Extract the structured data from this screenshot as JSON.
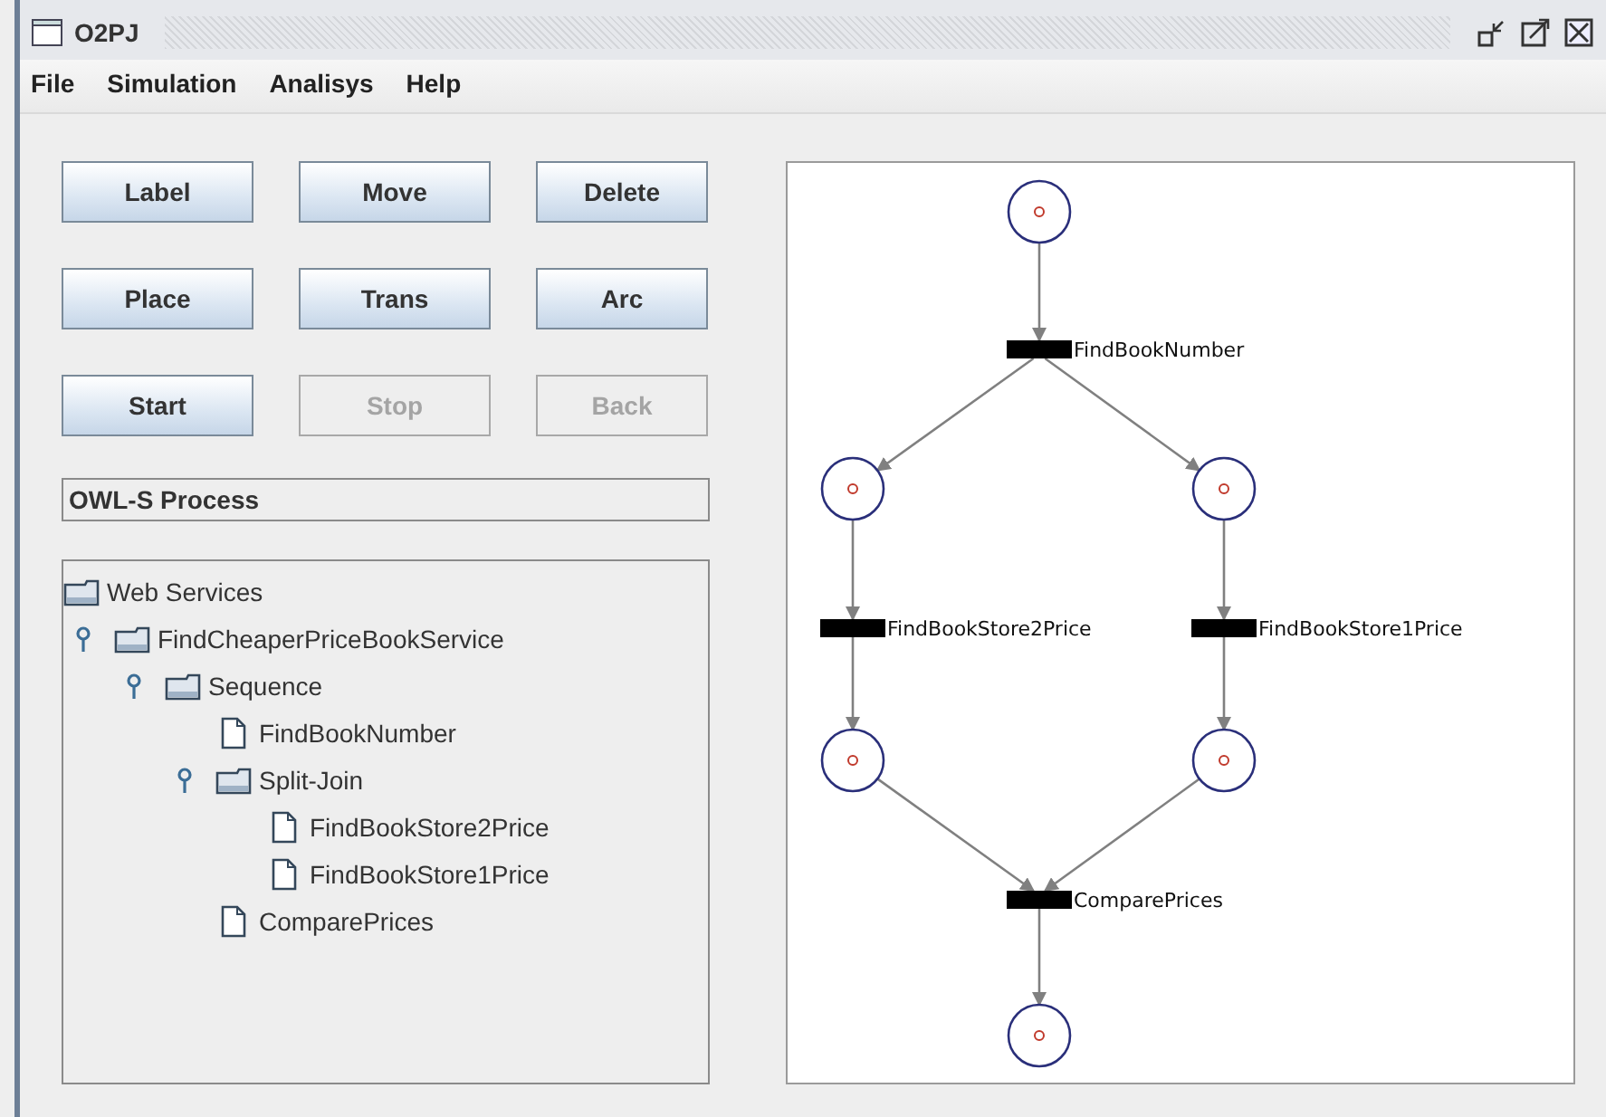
{
  "window": {
    "title": "O2PJ"
  },
  "menu": [
    "File",
    "Simulation",
    "Analisys",
    "Help"
  ],
  "buttons": [
    {
      "label": "Label",
      "disabled": false
    },
    {
      "label": "Move",
      "disabled": false
    },
    {
      "label": "Delete",
      "disabled": false
    },
    {
      "label": "Place",
      "disabled": false
    },
    {
      "label": "Trans",
      "disabled": false
    },
    {
      "label": "Arc",
      "disabled": false
    },
    {
      "label": "Start",
      "disabled": false
    },
    {
      "label": "Stop",
      "disabled": true
    },
    {
      "label": "Back",
      "disabled": true
    }
  ],
  "process_field": {
    "value": "OWL-S Process"
  },
  "tree": [
    {
      "label": "Web Services",
      "kind": "folder",
      "children": [
        {
          "label": "FindCheaperPriceBookService",
          "kind": "folder",
          "expanded": true,
          "children": [
            {
              "label": "Sequence",
              "kind": "folder",
              "expanded": true,
              "children": [
                {
                  "label": "FindBookNumber",
                  "kind": "file"
                },
                {
                  "label": "Split-Join",
                  "kind": "folder",
                  "expanded": true,
                  "children": [
                    {
                      "label": "FindBookStore2Price",
                      "kind": "file"
                    },
                    {
                      "label": "FindBookStore1Price",
                      "kind": "file"
                    }
                  ]
                },
                {
                  "label": "ComparePrices",
                  "kind": "file"
                }
              ]
            }
          ]
        }
      ]
    }
  ],
  "petri_net": {
    "transitions": [
      {
        "label": "FindBookNumber"
      },
      {
        "label": "FindBookStore2Price"
      },
      {
        "label": "FindBookStore1Price"
      },
      {
        "label": "ComparePrices"
      }
    ]
  }
}
